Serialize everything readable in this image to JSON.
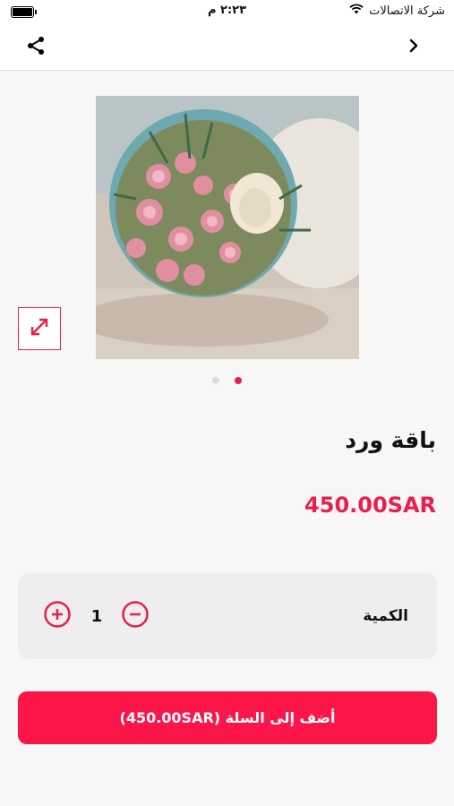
{
  "status_bar": {
    "carrier": "شركة الاتصالات",
    "time": "٢:٢٣ م"
  },
  "product": {
    "name": "باقة ورد",
    "price": "450.00SAR",
    "image_count": 2,
    "active_image_index": 1
  },
  "quantity": {
    "label": "الكمية",
    "value": "1"
  },
  "add_to_cart": {
    "label": "أضف إلى السلة (450.00SAR)"
  },
  "colors": {
    "accent": "#e91e4d",
    "button": "#fb1649"
  },
  "icons": [
    "share-icon",
    "chevron-right-icon",
    "expand-icon",
    "plus-circle-icon",
    "minus-circle-icon",
    "wifi-icon",
    "battery-icon"
  ]
}
